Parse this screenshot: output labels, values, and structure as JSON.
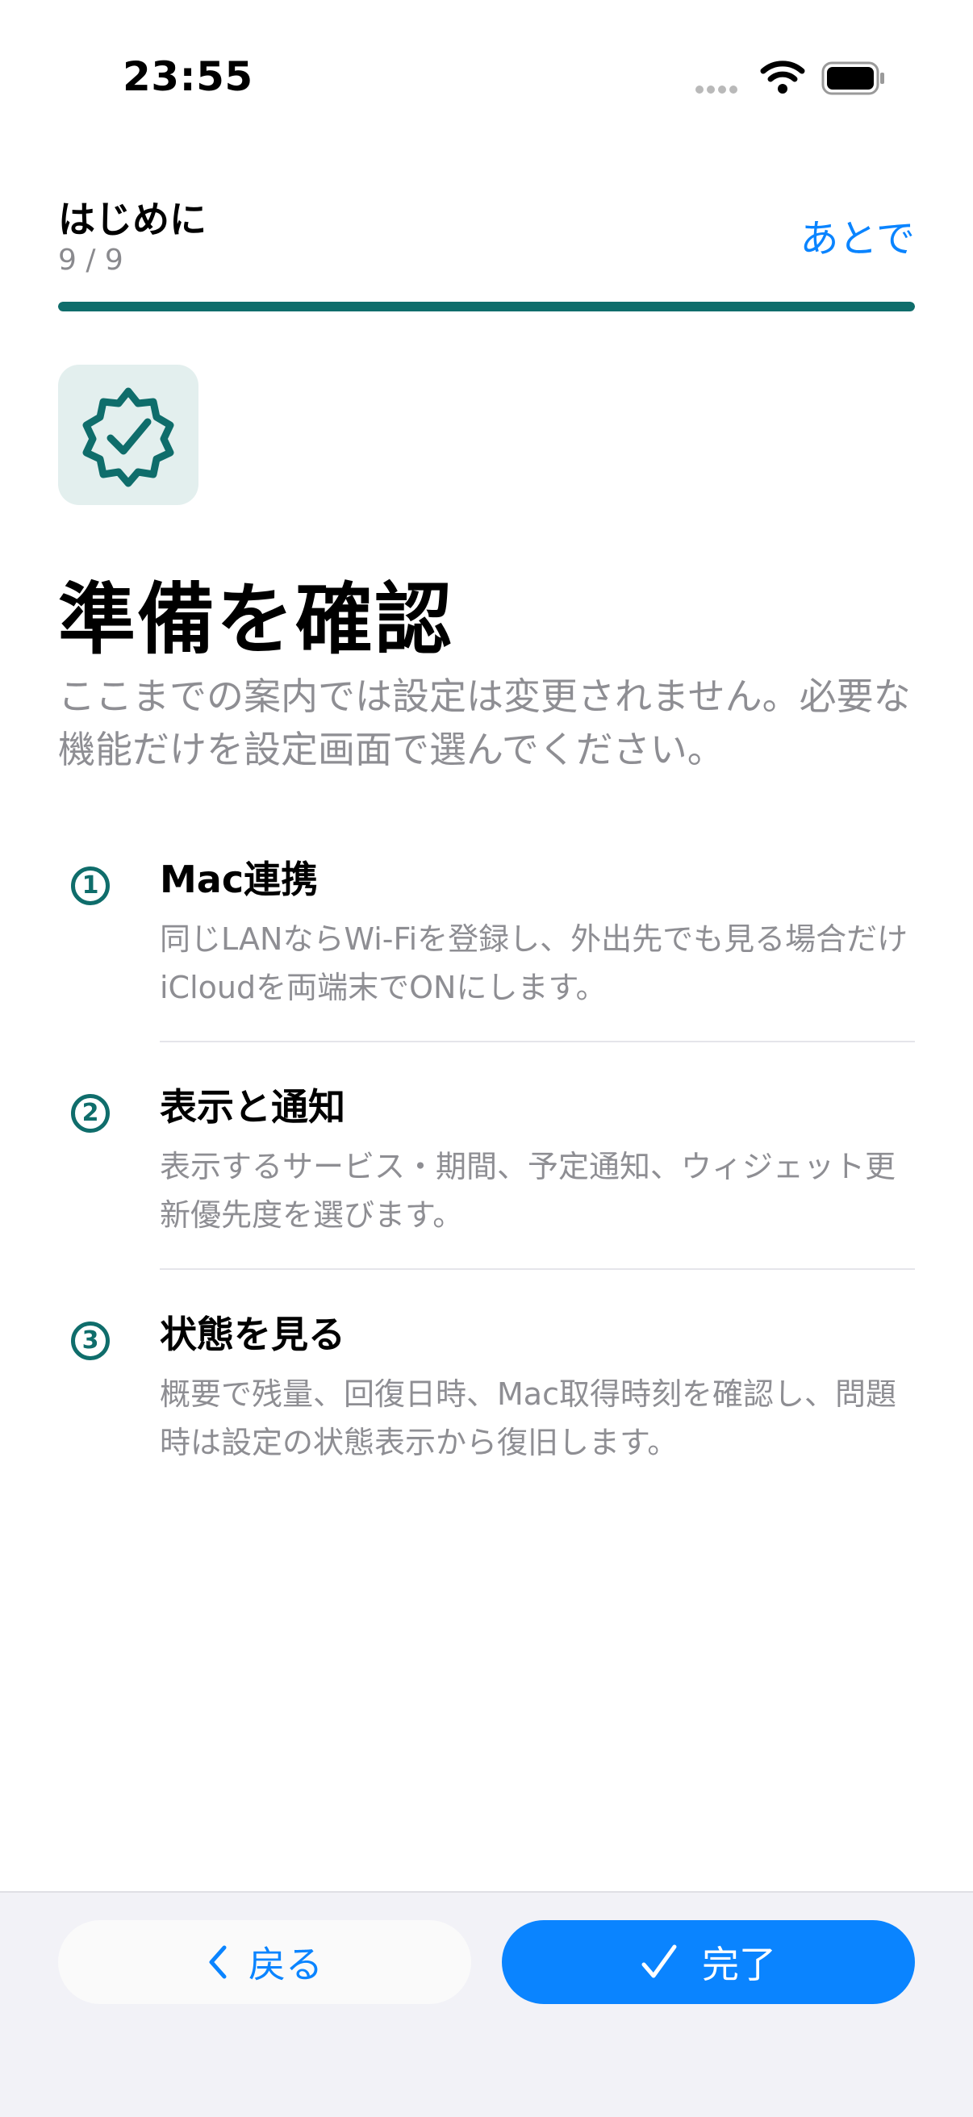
{
  "status_bar": {
    "time": "23:55"
  },
  "header": {
    "title": "はじめに",
    "step": "9 / 9",
    "later_link": "あとで",
    "progress": 1.0
  },
  "icon": {
    "name": "verified-badge-icon",
    "tile_color": "#e3efee",
    "accent": "#0f6d6b"
  },
  "main": {
    "title": "準備を確認",
    "description": "ここまでの案内では設定は変更されません。必要な機能だけを設定画面で選んでください。"
  },
  "steps": [
    {
      "number": "1",
      "title": "Mac連携",
      "text": "同じLANならWi-Fiを登録し、外出先でも見る場合だけiCloudを両端末でONにします。"
    },
    {
      "number": "2",
      "title": "表示と通知",
      "text": "表示するサービス・期間、予定通知、ウィジェット更新優先度を選びます。"
    },
    {
      "number": "3",
      "title": "状態を見る",
      "text": "概要で残量、回復日時、Mac取得時刻を確認し、問題時は設定の状態表示から復旧します。"
    }
  ],
  "footer": {
    "back_label": "戻る",
    "done_label": "完了"
  },
  "colors": {
    "accent_blue": "#0a84ff",
    "teal": "#0f6d6b"
  }
}
